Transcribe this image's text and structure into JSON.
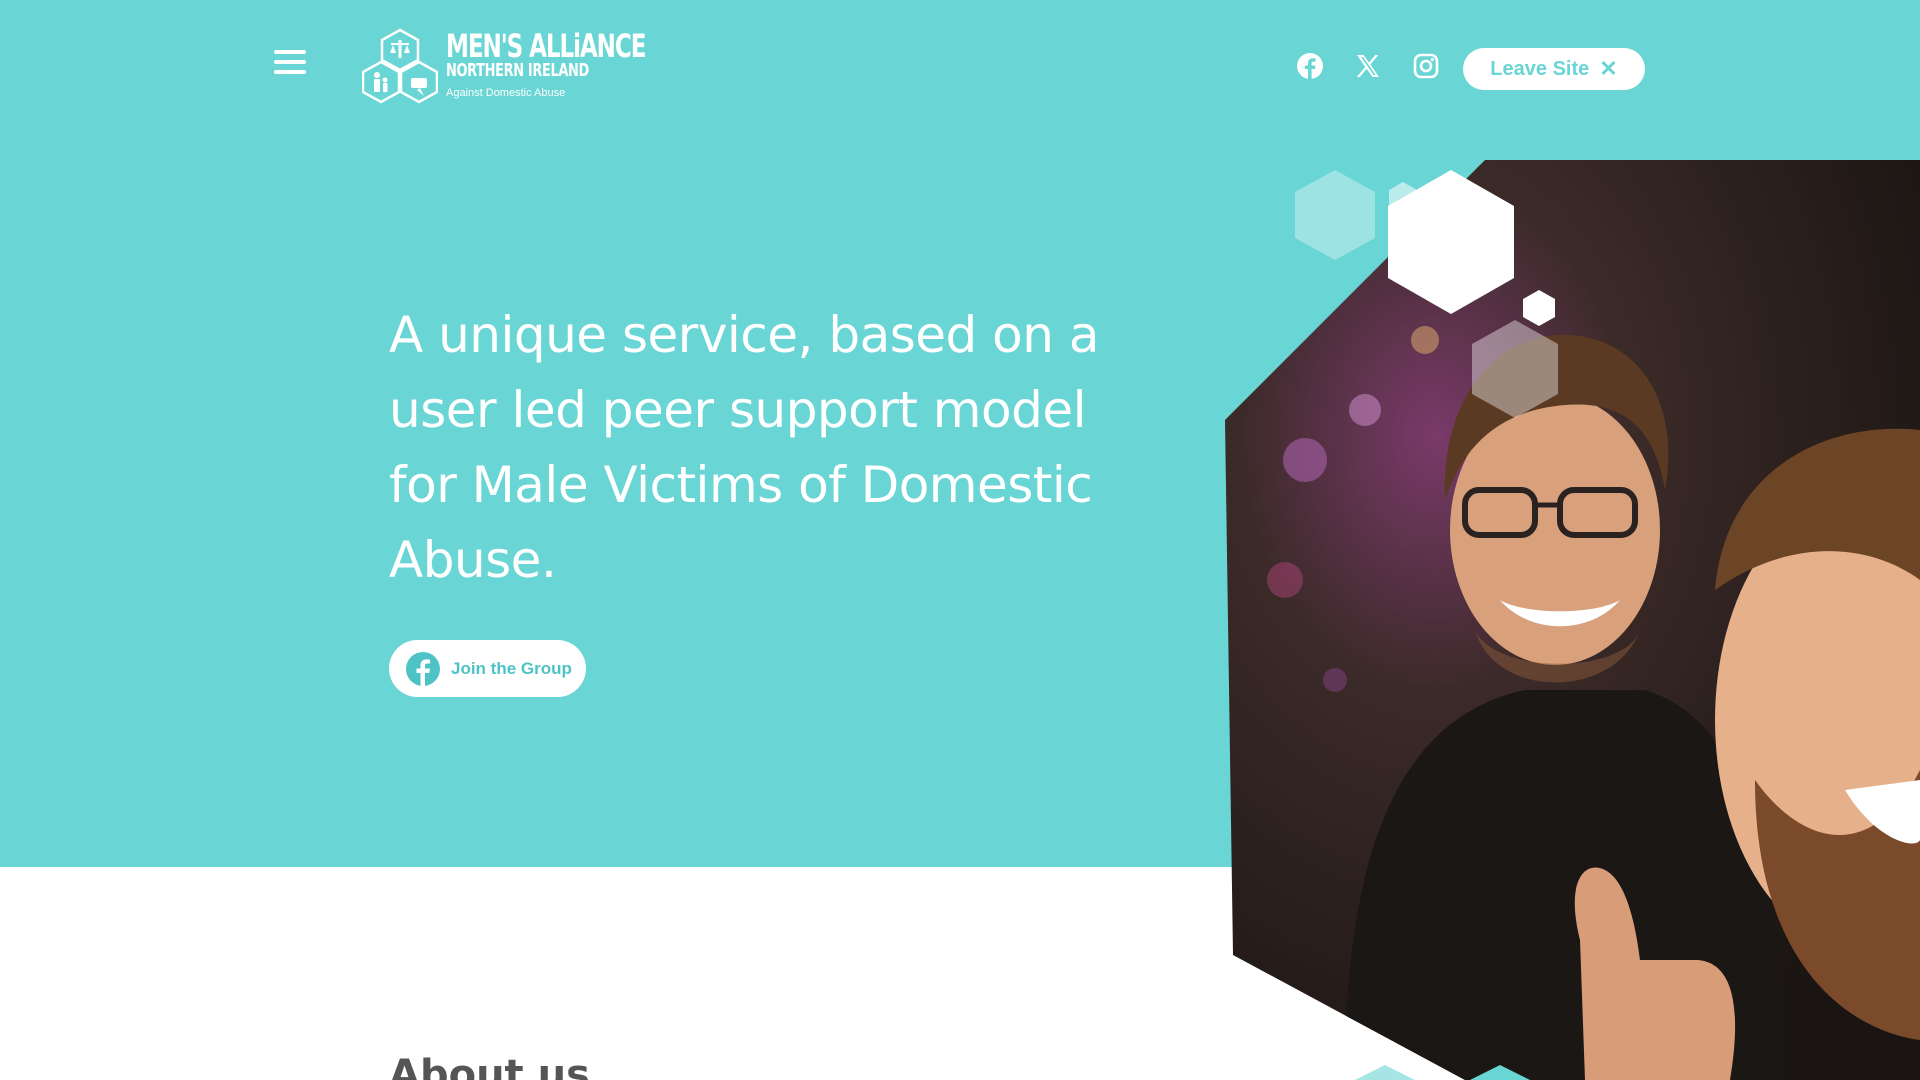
{
  "header": {
    "menu_icon": "hamburger-menu-icon",
    "logo": {
      "line1": "MEN'S ALLiANCE",
      "line2": "NORTHERN IRELAND",
      "line3": "Against Domestic Abuse"
    },
    "social": [
      {
        "name": "Facebook",
        "icon": "facebook-icon"
      },
      {
        "name": "X",
        "icon": "x-twitter-icon"
      },
      {
        "name": "Instagram",
        "icon": "instagram-icon"
      }
    ],
    "leave_site_label": "Leave Site",
    "leave_site_icon": "close-icon"
  },
  "hero": {
    "headline": "A unique service, based on a user led peer support model for Male Victims of Domestic Abuse.",
    "join_label": "Join the Group",
    "join_icon": "facebook-icon"
  },
  "about": {
    "heading": "About us"
  },
  "colors": {
    "brand_teal": "#69d5d4",
    "button_text": "#4ec3c5",
    "white": "#ffffff"
  }
}
